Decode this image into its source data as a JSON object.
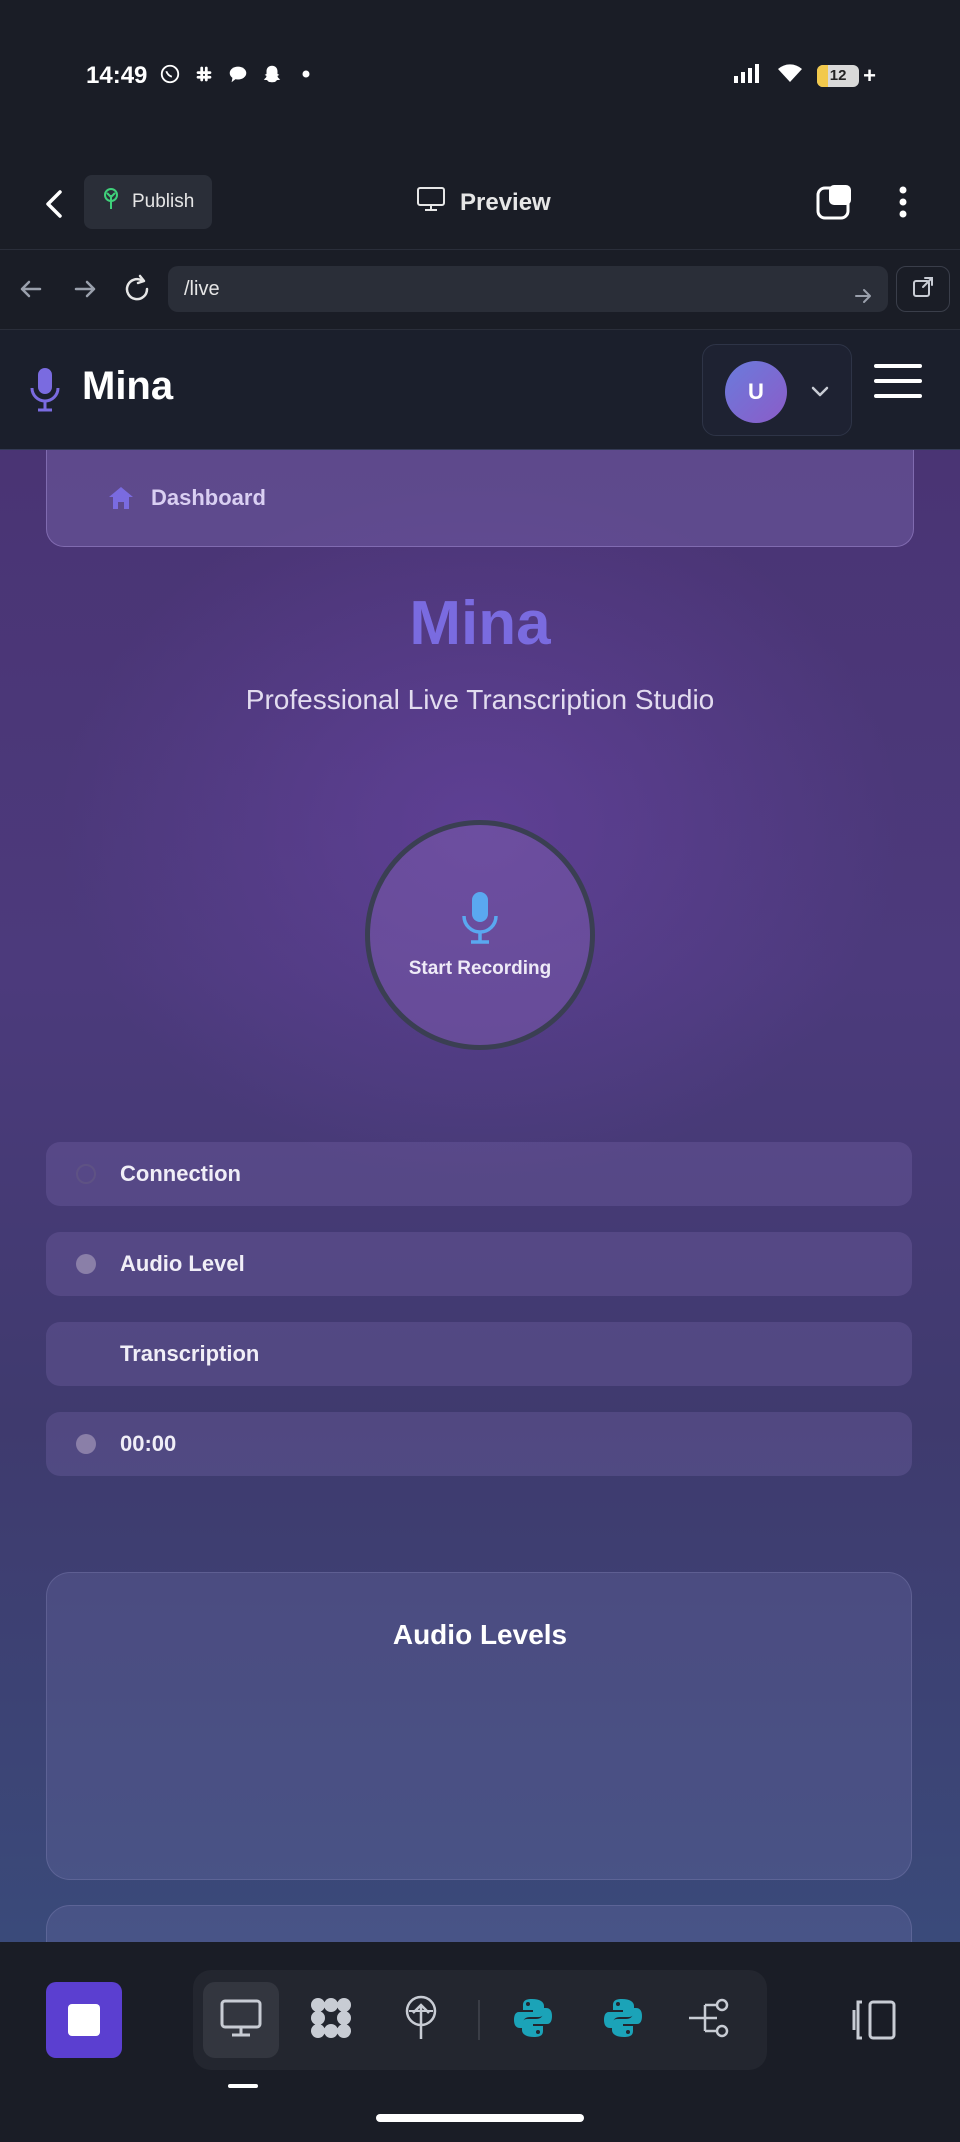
{
  "status_bar": {
    "time": "14:49",
    "battery": "12",
    "notification_icons": [
      "whatsapp-icon",
      "slack-icon",
      "chat-bubble-icon",
      "snapchat-icon",
      "dot-icon"
    ]
  },
  "toolbar": {
    "publish_label": "Publish",
    "preview_label": "Preview"
  },
  "browser": {
    "url": "/live"
  },
  "site_header": {
    "brand": "Mina",
    "avatar_initial": "U"
  },
  "breadcrumb": {
    "label": "Dashboard"
  },
  "hero": {
    "title": "Mina",
    "subtitle": "Professional Live Transcription Studio"
  },
  "record_button": {
    "label": "Start Recording"
  },
  "status_items": [
    {
      "label": "Connection",
      "indicator": "ring"
    },
    {
      "label": "Audio Level",
      "indicator": "dot"
    },
    {
      "label": "Transcription",
      "indicator": "none"
    },
    {
      "label": "00:00",
      "indicator": "dot"
    }
  ],
  "audio_levels": {
    "title": "Audio Levels"
  },
  "colors": {
    "accent": "#7a6be0",
    "stop_button": "#5b3fd0",
    "python_teal": "#1ba3b8"
  },
  "dock": {
    "items": [
      "desktop-icon",
      "puzzle-grid-icon",
      "publish-tree-icon",
      "python-icon",
      "python-icon",
      "workflow-icon"
    ]
  }
}
